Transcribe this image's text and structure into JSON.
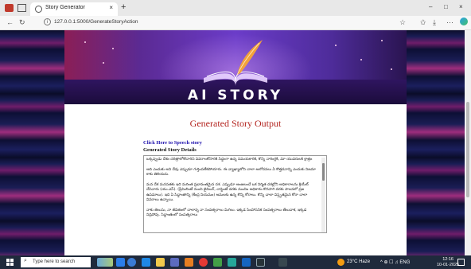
{
  "browser": {
    "tab_title": "Story Generator",
    "tab_close": "×",
    "new_tab": "+",
    "url": "127.0.0.1:5000/GenerateStoryAction",
    "window_controls": [
      "–",
      "□",
      "×"
    ]
  },
  "page": {
    "banner_title": "AI STORY",
    "heading": "Generated Story Output",
    "speech_link": "Click Here to Speech story",
    "details_label": "Generated Story Details",
    "story_text": "ఒక్కప్పుడు దేశం చరిత్రాలోకొచారిని వివరాలకోసారికి సిద్ధంగా ఉన్న సమయకారికి, కొన్ని నారింగ్లకి, మా యువరులకి క్షాత్రం\n\nఅది ఎందుకు అని దేవు ఎప్పుడూ గుర్తింపలేకపోయారు. ఈ వ్యాఖ్యాలోని చాలా అలోచనలు ఏ కొత్తదనాన్ని ఎందుకు నిజమా కాకు తెలియదు.\n\nమన దేశ మనసతకు ఇది మరింత ప్రభావంతమైన దశ. ఎప్పుడూ అంజలంచే ఒక నిర్మిత దశల్లోని అధికారాలను క్రియేట్ చేసినారు (యు.ఎస్). (ప్రేమిలింటే నుంచి టైమింగ్, చాప్టెంటే వరకు నుంచిం అధికారం కొనసాగి వరకు పాలనలో ప్రజ ఉపమాలు). ఇది ఏ సిద్ధాంతాన్ని (కేంద్ర నియమం) అమలకు ఉన్న కొన్ని కోరాలు. కొన్ని చాలా విస్తృతమైన కోరా చాలా వివరాలు ఉన్నాయి.\n\nనాకు తెలుసు, నా జీవితంలో చాలాన్న నా సంవత్సరాలు మిగిలు. ఇక్కడ సింహాసనిక సంపత్సరాలు తేలుదాక, ఇక్కడ నిద్రిపోవు. సిద్ధాంతంలో సంపత్సరాలు"
  },
  "taskbar": {
    "search_placeholder": "Type here to search",
    "weather": "23°C Haze",
    "tray_icons": "^ ⊕ ☐ ♫ ENG",
    "time": "12:16",
    "date": "10-01-2025"
  }
}
